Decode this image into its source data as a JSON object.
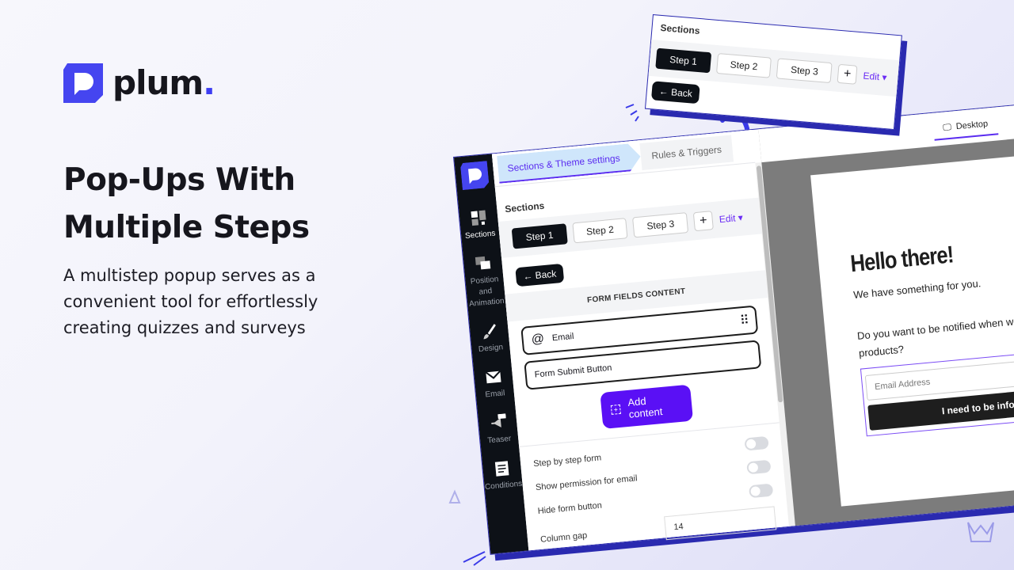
{
  "brand": {
    "name": "plum",
    "dot": ".",
    "color": "#4545f0"
  },
  "hero": {
    "title": "Pop-Ups With Multiple Steps",
    "subtitle": "A multistep popup serves as a convenient tool for effortlessly creating quizzes and surveys"
  },
  "editor": {
    "sidebar": [
      {
        "label": "Sections",
        "icon": "sections-icon"
      },
      {
        "label": "Position and Animation",
        "icon": "layers-icon"
      },
      {
        "label": "Design",
        "icon": "brush-icon"
      },
      {
        "label": "Email",
        "icon": "envelope-icon"
      },
      {
        "label": "Teaser",
        "icon": "megaphone-icon",
        "badge": "Teaser"
      },
      {
        "label": "Conditions",
        "icon": "checklist-icon"
      }
    ],
    "tabs": [
      "Sections & Theme settings",
      "Rules & Triggers"
    ],
    "sections_title": "Sections",
    "steps": [
      "Step 1",
      "Step 2",
      "Step 3"
    ],
    "add_step": "+",
    "edit": "Edit ▾",
    "back": "← Back",
    "form_fields_title": "FORM FIELDS CONTENT",
    "fields": [
      "Email",
      "Form Submit Button"
    ],
    "add_content": "Add content",
    "toggles": [
      {
        "label": "Step by step form",
        "on": false
      },
      {
        "label": "Show permission for email",
        "on": false
      },
      {
        "label": "Hide form button",
        "on": false
      }
    ],
    "column_gap": {
      "label": "Column gap",
      "value": "14"
    },
    "device": "Desktop",
    "popup": {
      "heading": "Hello there!",
      "text": "We have something for you.",
      "question": "Do you want to be notified when we release new products?",
      "email_placeholder": "Email Address",
      "button": "I need to be informed."
    }
  },
  "accent": "#5a10f5"
}
